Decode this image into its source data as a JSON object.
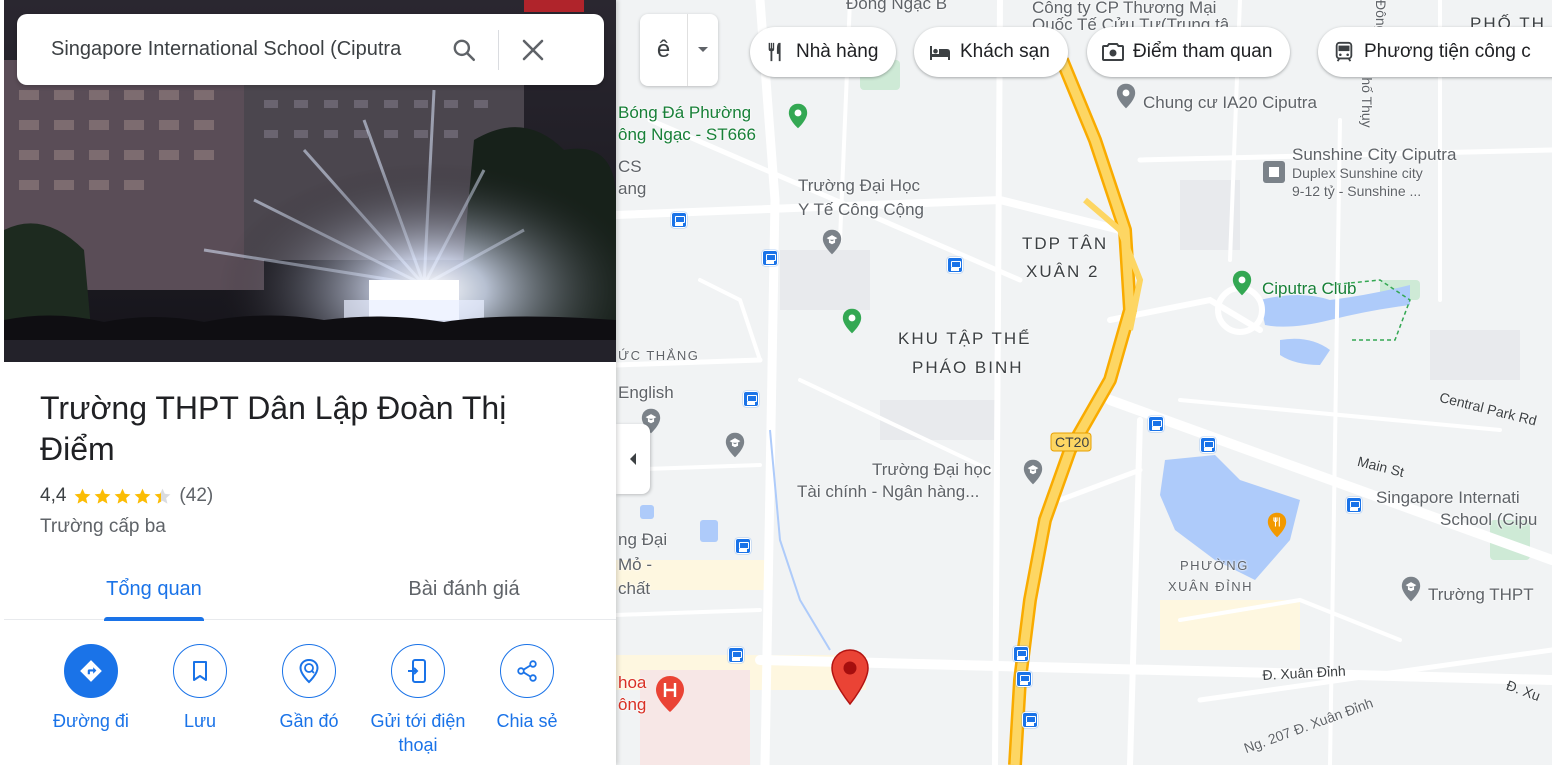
{
  "search": {
    "value": "Singapore International School (Ciputra"
  },
  "place": {
    "title": "Trường THPT Dân Lập Đoàn Thị Điểm",
    "rating": "4,4",
    "stars": 4.4,
    "reviews": "(42)",
    "category": "Trường cấp ba"
  },
  "tabs": [
    {
      "label": "Tổng quan",
      "active": true
    },
    {
      "label": "Bài đánh giá",
      "active": false
    }
  ],
  "actions": [
    {
      "label": "Đường đi",
      "icon": "directions-icon"
    },
    {
      "label": "Lưu",
      "icon": "bookmark-icon"
    },
    {
      "label": "Gần đó",
      "icon": "nearby-icon"
    },
    {
      "label": "Gửi tới điện thoại",
      "icon": "send-to-phone-icon"
    },
    {
      "label": "Chia sẻ",
      "icon": "share-icon"
    }
  ],
  "map_controls": {
    "layer_glyph": "ê"
  },
  "chips": [
    {
      "label": "Nhà hàng",
      "icon": "restaurant-icon"
    },
    {
      "label": "Khách sạn",
      "icon": "hotel-icon"
    },
    {
      "label": "Điểm tham quan",
      "icon": "camera-icon"
    },
    {
      "label": "Phương tiện công c",
      "icon": "transit-icon"
    }
  ],
  "map_labels": {
    "dong_ngac_top": "Đông Ngạc B",
    "cong_ty": "Công ty CP Thương Mại",
    "quoc_te": "Quốc Tế Cửu Tư(Trung tâ",
    "pho_th": "PHỐ TH",
    "bong_da_1": "Bóng Đá Phường",
    "bong_da_2": "ông Ngạc - ST666",
    "cs": "CS",
    "ang": "ang",
    "chung_cu": "Chung cư IA20 Ciputra",
    "sunshine_1": "Sunshine City Ciputra",
    "sunshine_2": "Duplex Sunshine city",
    "sunshine_3": "9-12 tỷ - Sunshine ...",
    "yte_1": "Trường Đại Học",
    "yte_2": "Y Tế Công Cộng",
    "tdp_1": "TDP TÂN",
    "tdp_2": "XUÂN 2",
    "ciputra_club": "Ciputra Club",
    "khu_1": "KHU TẬP THỂ",
    "khu_2": "PHÁO BINH",
    "uc_thang": "ỨC THẮNG",
    "english": "English",
    "central_park": "Central Park Rd",
    "ct20": "CT20",
    "main_st": "Main St",
    "taichinh_1": "Trường Đại học",
    "taichinh_2": "Tài chính - Ngân hàng...",
    "singapore_1": "Singapore Internati",
    "singapore_2": "School (Cipu",
    "ng_dai": "ng Đại",
    "mo": "Mỏ -",
    "chat": "chất",
    "phuong_1": "PHƯỜNG",
    "phuong_2": "XUÂN ĐỈNH",
    "truong_thpt": "Trường THPT",
    "khoa": "hoa",
    "ong": "ông",
    "xuan_dinh": "Đ. Xuân Đỉnh",
    "d_xu": "Đ. Xu",
    "ng207": "Ng. 207 Đ. Xuân Đỉnh",
    "pho_thuy": "Phố Thụy",
    "dong_ngac_v": "Đông Ngạc"
  }
}
